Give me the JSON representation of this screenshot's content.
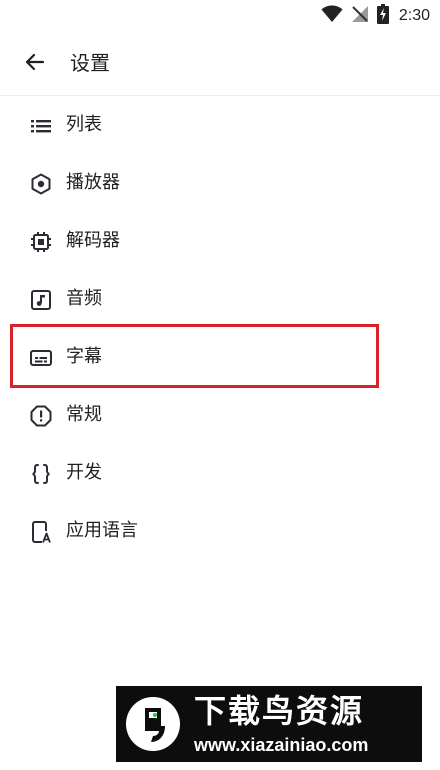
{
  "status_bar": {
    "time": "2:30",
    "icons": [
      "wifi-icon",
      "no-signal-icon",
      "battery-charging-icon"
    ]
  },
  "header": {
    "back_icon": "arrow-left-icon",
    "title": "设置"
  },
  "settings": {
    "items": [
      {
        "label": "列表",
        "icon": "list-icon"
      },
      {
        "label": "播放器",
        "icon": "player-hexagon-icon"
      },
      {
        "label": "解码器",
        "icon": "chip-icon"
      },
      {
        "label": "音频",
        "icon": "music-note-icon"
      },
      {
        "label": "字幕",
        "icon": "subtitles-icon",
        "highlighted": true
      },
      {
        "label": "常规",
        "icon": "info-octagon-icon"
      },
      {
        "label": "开发",
        "icon": "code-braces-icon"
      },
      {
        "label": "应用语言",
        "icon": "app-language-icon"
      }
    ]
  },
  "highlight_color": "#d8232a",
  "watermark": {
    "title": "下载鸟资源",
    "url": "www.xiazainiao.com",
    "background": "#0d0d0d"
  }
}
